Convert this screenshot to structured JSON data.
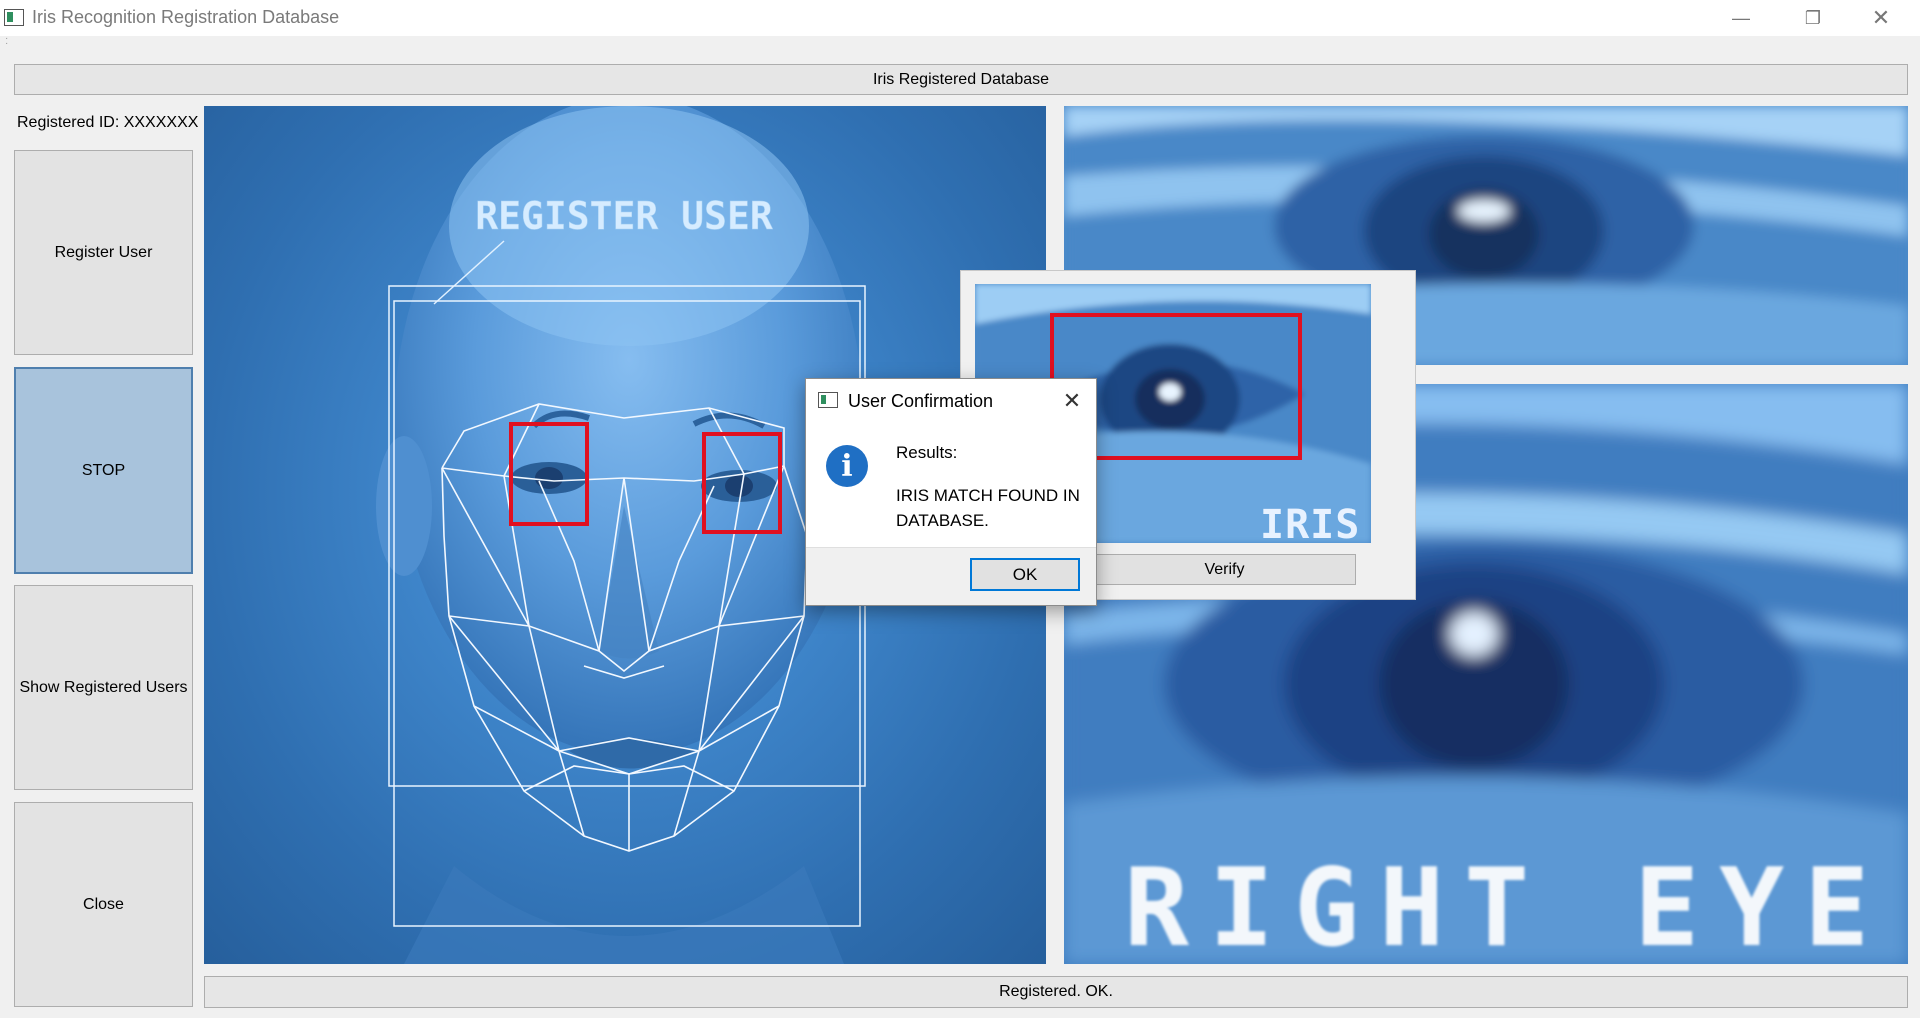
{
  "window": {
    "title": "Iris Recognition Registration Database",
    "controls": {
      "minimize": "—",
      "restore": "❐",
      "close": "✕"
    }
  },
  "header": {
    "title": "Iris Registered Database"
  },
  "sidebar": {
    "registered_id": "Registered ID: XXXXXXX",
    "buttons": {
      "register": "Register User",
      "stop": "STOP",
      "show_users": "Show Registered Users",
      "close": "Close"
    }
  },
  "face_panel": {
    "caption": "REGISTER USER"
  },
  "eye_panel": {
    "caption": "RIGHT EYE"
  },
  "verify_window": {
    "iris_label": "IRIS",
    "verify_button": "Verify"
  },
  "dialog": {
    "title": "User Confirmation",
    "close": "✕",
    "icon": "i",
    "heading": "Results:",
    "message": "IRIS MATCH FOUND IN DATABASE.",
    "ok_button": "OK"
  },
  "status": {
    "text": "Registered. OK."
  },
  "colors": {
    "stop_button_bg": "#a8c3dc",
    "face_bg": "#3f86cb",
    "detection_box": "#e01020",
    "dialog_accent": "#0078d7",
    "info_icon": "#1f6fc4"
  }
}
